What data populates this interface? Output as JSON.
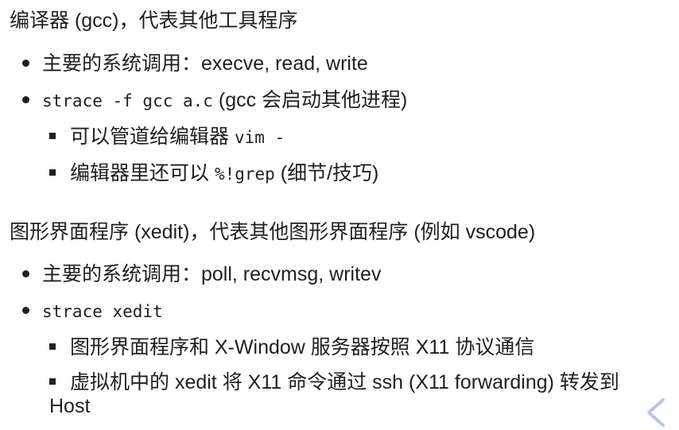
{
  "section1": {
    "heading": "编译器 (gcc)，代表其他工具程序",
    "b1": "主要的系统调用：execve, read, write",
    "b2_code": "strace -f gcc a.c",
    "b2_text": " (gcc 会启动其他进程)",
    "s1_text": "可以管道给编辑器 ",
    "s1_code": "vim -",
    "s2_text": "编辑器里还可以 ",
    "s2_code": "%!grep",
    "s2_tail": " (细节/技巧)"
  },
  "section2": {
    "heading": "图形界面程序 (xedit)，代表其他图形界面程序 (例如 vscode)",
    "b1": "主要的系统调用：poll, recvmsg, writev",
    "b2_code": "strace xedit",
    "s1": "图形界面程序和 X-Window 服务器按照 X11 协议通信",
    "s2": "虚拟机中的 xedit 将 X11 命令通过 ssh (X11 forwarding) 转发到 Host"
  }
}
